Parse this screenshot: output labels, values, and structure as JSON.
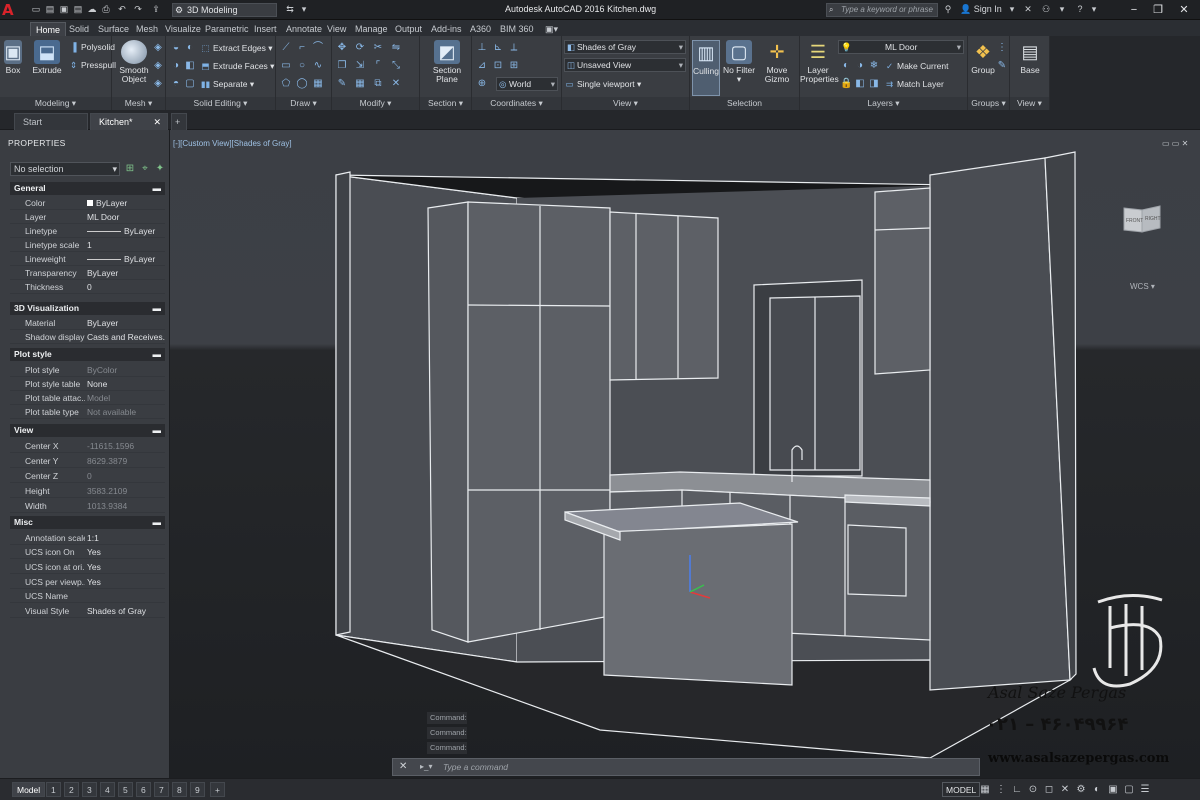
{
  "titlebar": {
    "workspace": "3D Modeling",
    "app_title": "Autodesk AutoCAD 2016   Kitchen.dwg",
    "search_placeholder": "Type a keyword or phrase",
    "signin": "Sign In"
  },
  "ribbon_tabs": [
    "Home",
    "Solid",
    "Surface",
    "Mesh",
    "Visualize",
    "Parametric",
    "Insert",
    "Annotate",
    "View",
    "Manage",
    "Output",
    "Add-ins",
    "A360",
    "BIM 360"
  ],
  "ribbon": {
    "modeling": {
      "title": "Modeling",
      "box": "Box",
      "extrude": "Extrude",
      "polysolid": "Polysolid",
      "presspull": "Presspull"
    },
    "mesh": {
      "title": "Mesh",
      "smooth_object": "Smooth Object"
    },
    "solid_editing": {
      "title": "Solid Editing",
      "extract_edges": "Extract Edges",
      "extrude_faces": "Extrude Faces",
      "separate": "Separate"
    },
    "draw": {
      "title": "Draw"
    },
    "modify": {
      "title": "Modify"
    },
    "section": {
      "title": "Section",
      "section_plane": "Section Plane"
    },
    "coordinates": {
      "title": "Coordinates",
      "world": "World"
    },
    "view": {
      "title": "View",
      "visual_style": "Shades of Gray",
      "saved_view": "Unsaved View",
      "viewport": "Single viewport"
    },
    "selection": {
      "title": "Selection",
      "culling": "Culling",
      "no_filter": "No Filter",
      "move_gizmo": "Move Gizmo"
    },
    "layers": {
      "title": "Layers",
      "layer_properties": "Layer Properties",
      "current_layer": "ML Door",
      "make_current": "Make Current",
      "match_layer": "Match Layer"
    },
    "groups": {
      "title": "Groups",
      "group": "Group"
    },
    "view2": {
      "title": "View",
      "base": "Base"
    }
  },
  "file_tabs": [
    "Start",
    "Kitchen*"
  ],
  "properties": {
    "title": "PROPERTIES",
    "selection": "No selection",
    "sections": [
      {
        "name": "General",
        "rows": [
          {
            "k": "Color",
            "v": "ByLayer"
          },
          {
            "k": "Layer",
            "v": "ML Door"
          },
          {
            "k": "Linetype",
            "v": "ByLayer"
          },
          {
            "k": "Linetype scale",
            "v": "1"
          },
          {
            "k": "Lineweight",
            "v": "ByLayer"
          },
          {
            "k": "Transparency",
            "v": "ByLayer"
          },
          {
            "k": "Thickness",
            "v": "0"
          }
        ]
      },
      {
        "name": "3D Visualization",
        "rows": [
          {
            "k": "Material",
            "v": "ByLayer"
          },
          {
            "k": "Shadow display",
            "v": "Casts and Receives..."
          }
        ]
      },
      {
        "name": "Plot style",
        "rows": [
          {
            "k": "Plot style",
            "v": "ByColor"
          },
          {
            "k": "Plot style table",
            "v": "None"
          },
          {
            "k": "Plot table attac...",
            "v": "Model"
          },
          {
            "k": "Plot table type",
            "v": "Not available"
          }
        ]
      },
      {
        "name": "View",
        "rows": [
          {
            "k": "Center X",
            "v": "-11615.1596"
          },
          {
            "k": "Center Y",
            "v": "8629.3879"
          },
          {
            "k": "Center Z",
            "v": "0"
          },
          {
            "k": "Height",
            "v": "3583.2109"
          },
          {
            "k": "Width",
            "v": "1013.9384"
          }
        ]
      },
      {
        "name": "Misc",
        "rows": [
          {
            "k": "Annotation scale",
            "v": "1:1"
          },
          {
            "k": "UCS icon On",
            "v": "Yes"
          },
          {
            "k": "UCS icon at ori...",
            "v": "Yes"
          },
          {
            "k": "UCS per viewp...",
            "v": "Yes"
          },
          {
            "k": "UCS Name",
            "v": ""
          },
          {
            "k": "Visual Style",
            "v": "Shades of Gray"
          }
        ]
      }
    ]
  },
  "viewport": {
    "label": "[-][Custom View][Shades of Gray]",
    "wcs": "WCS",
    "viewcube": {
      "front": "FRONT",
      "right": "RIGHT"
    }
  },
  "command": {
    "history": [
      "Command:",
      "Command:",
      "Command:"
    ],
    "placeholder": "Type a command"
  },
  "layout_tabs": [
    "Model",
    "1",
    "2",
    "3",
    "4",
    "5",
    "6",
    "7",
    "8",
    "9"
  ],
  "status": {
    "model": "MODEL"
  },
  "watermark": {
    "name": "Asal Saze Pergas",
    "phone": "۰۲۱ – ۴۶۰۴۹۹۶۴",
    "url": "www.asalsazepergas.com"
  }
}
